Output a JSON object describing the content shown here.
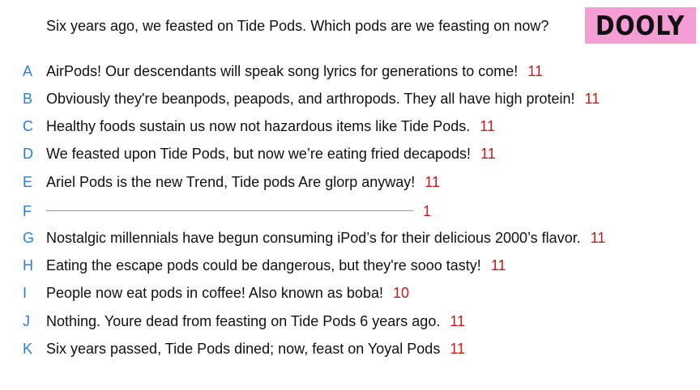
{
  "prompt": "Six years ago, we feasted on Tide Pods. Which pods are we feasting on now?",
  "badge": "DOOLY",
  "colors": {
    "letter": "#2a7fe0",
    "score": "#cc1a1a",
    "badge_bg": "#f59ed6"
  },
  "answers": [
    {
      "letter": "A",
      "text": "AirPods! Our descendants will speak song lyrics for generations to come!",
      "score": "11"
    },
    {
      "letter": "B",
      "text": "Obviously they're beanpods, peapods, and arthropods. They all have high protein!",
      "score": "11"
    },
    {
      "letter": "C",
      "text": "Healthy foods sustain us now not hazardous items like Tide Pods.",
      "score": "11"
    },
    {
      "letter": "D",
      "text": "We feasted upon Tide Pods, but now we’re eating fried decapods!",
      "score": "11"
    },
    {
      "letter": "E",
      "text": "Ariel Pods is the new Trend, Tide pods Are glorp anyway!",
      "score": "11"
    },
    {
      "letter": "F",
      "text": "",
      "score": "1"
    },
    {
      "letter": "G",
      "text": "Nostalgic millennials have begun consuming iPod’s for their delicious 2000’s flavor.",
      "score": "11"
    },
    {
      "letter": "H",
      "text": "Eating the escape pods could be dangerous, but they're sooo tasty!",
      "score": "11"
    },
    {
      "letter": "I",
      "text": "People now eat pods in coffee! Also known as boba!",
      "score": "10"
    },
    {
      "letter": "J",
      "text": "Nothing. Youre dead from feasting on Tide Pods 6 years ago.",
      "score": "11"
    },
    {
      "letter": "K",
      "text": "Six years passed, Tide Pods dined; now, feast on Yoyal Pods",
      "score": "11"
    }
  ]
}
